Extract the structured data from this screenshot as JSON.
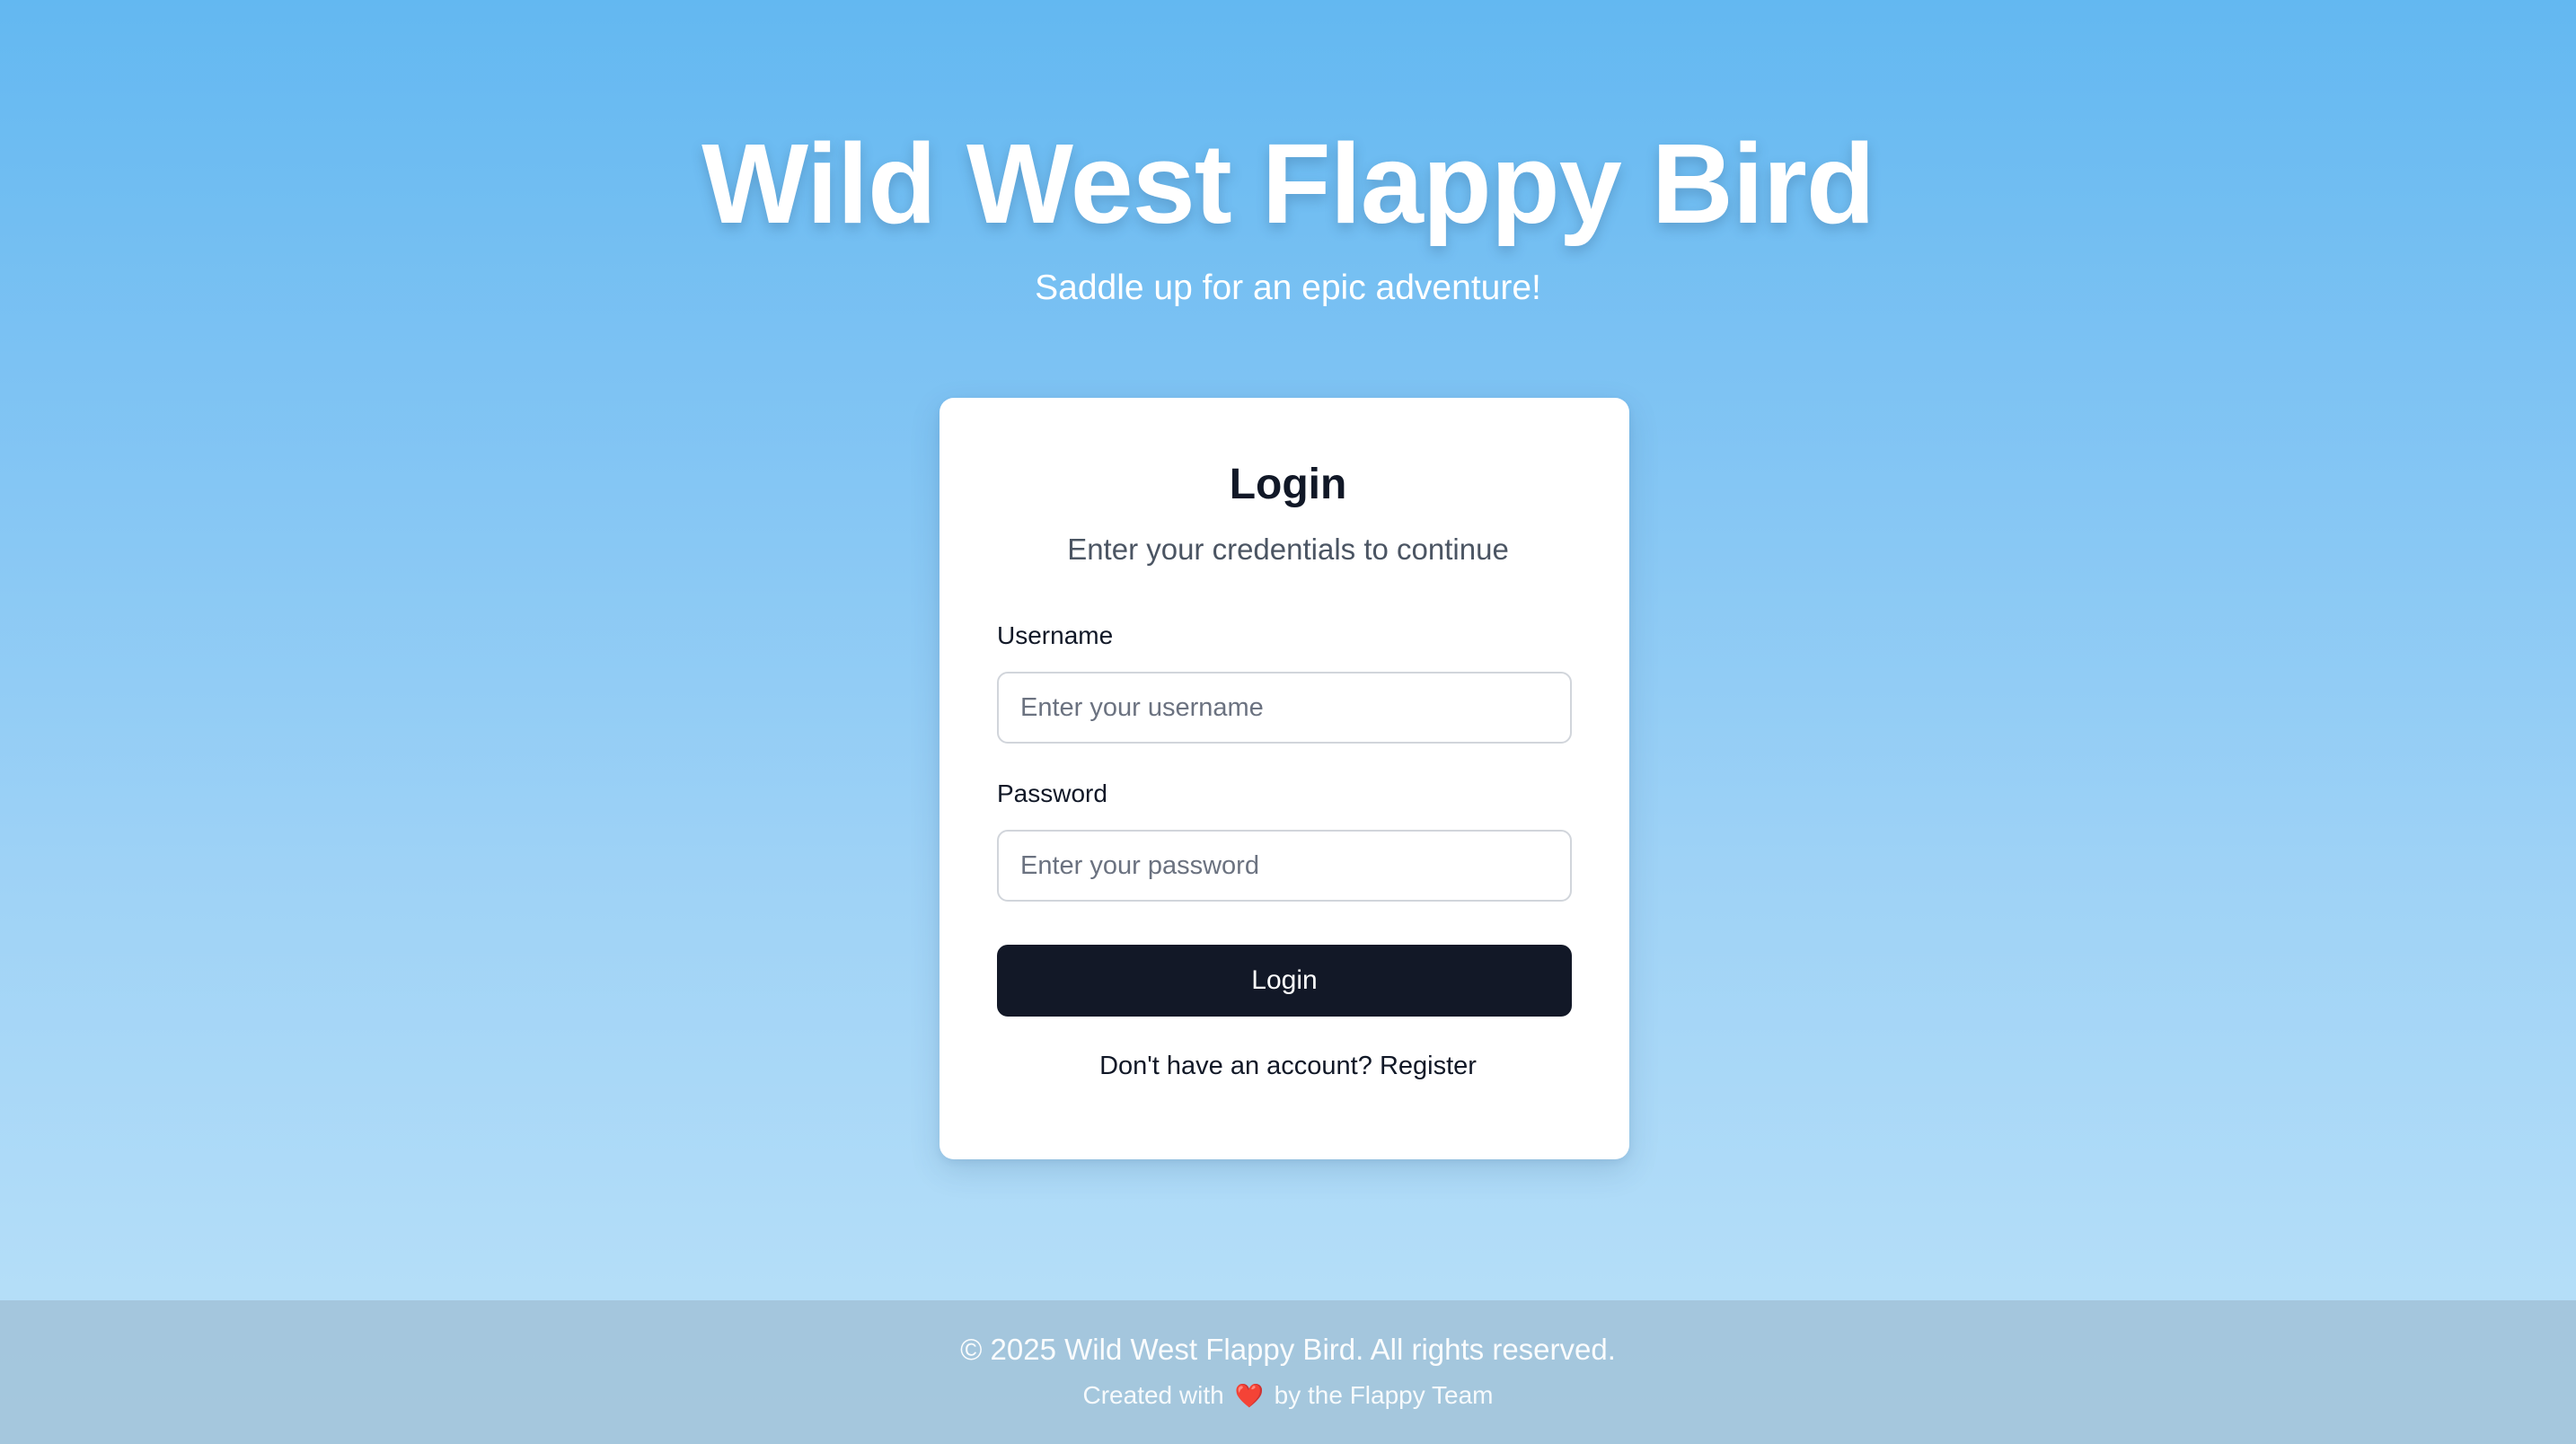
{
  "header": {
    "title": "Wild West Flappy Bird",
    "subtitle": "Saddle up for an epic adventure!"
  },
  "login_card": {
    "title": "Login",
    "subtitle": "Enter your credentials to continue",
    "username": {
      "label": "Username",
      "value": "",
      "placeholder": "Enter your username"
    },
    "password": {
      "label": "Password",
      "value": "",
      "placeholder": "Enter your password"
    },
    "submit_label": "Login",
    "register_prompt": "Don't have an account?",
    "register_link": "Register"
  },
  "footer": {
    "copyright": "© 2025 Wild West Flappy Bird. All rights reserved.",
    "created_prefix": "Created with",
    "heart_glyph": "❤️",
    "created_suffix": "by the Flappy Team",
    "heart_icon": "heart-icon"
  },
  "colors": {
    "sky_top": "#63b8f1",
    "sky_bottom": "#bce2f9",
    "card_background": "#ffffff",
    "button_background": "#121827",
    "footer_background": "#a0c1d7",
    "heart": "#ef4444"
  }
}
